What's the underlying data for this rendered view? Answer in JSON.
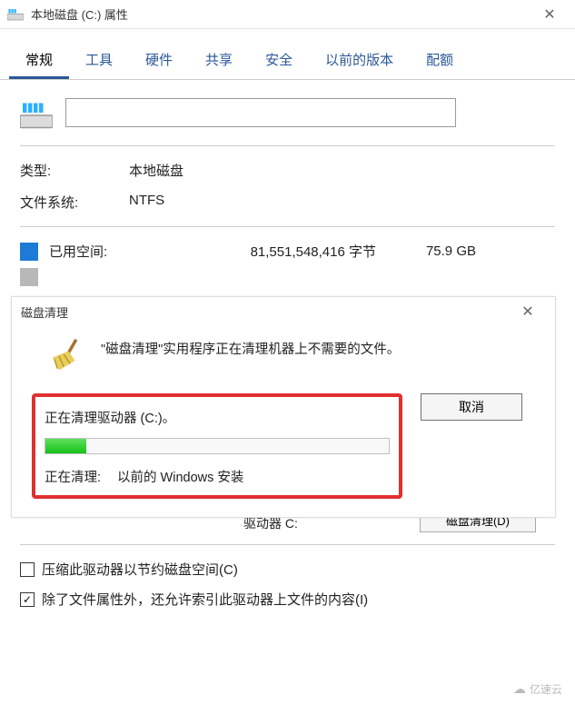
{
  "window": {
    "title": "本地磁盘 (C:) 属性"
  },
  "tabs": {
    "t0": "常规",
    "t1": "工具",
    "t2": "硬件",
    "t3": "共享",
    "t4": "安全",
    "t5": "以前的版本",
    "t6": "配额"
  },
  "general": {
    "name_value": "",
    "type_label": "类型:",
    "type_value": "本地磁盘",
    "fs_label": "文件系统:",
    "fs_value": "NTFS",
    "used_label": "已用空间:",
    "used_bytes": "81,551,548,416 字节",
    "used_size": "75.9 GB",
    "drive_line": "驱动器 C:",
    "cleanup_btn": "磁盘清理(D)",
    "compress_label": "压缩此驱动器以节约磁盘空间(C)",
    "index_label": "除了文件属性外，还允许索引此驱动器上文件的内容(I)"
  },
  "dialog": {
    "title": "磁盘清理",
    "message": "\"磁盘清理\"实用程序正在清理机器上不需要的文件。",
    "cleaning_line": "正在清理驱动器  (C:)。",
    "progress_percent": 12,
    "status_label": "正在清理:",
    "status_value": "以前的 Windows 安装",
    "cancel": "取消"
  },
  "watermark": "亿速云"
}
